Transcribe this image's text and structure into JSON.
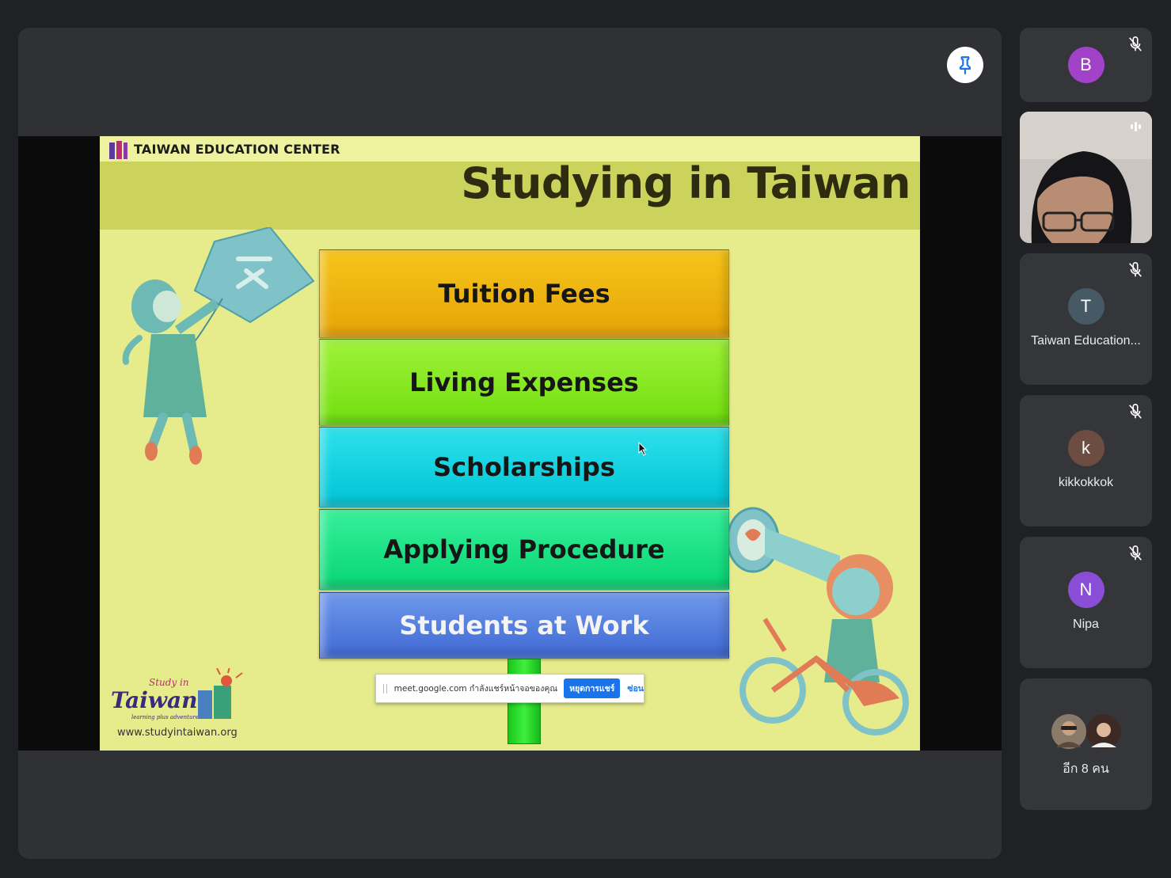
{
  "presentation": {
    "org_label": "TAIWAN EDUCATION CENTER",
    "slide_title": "Studying in Taiwan",
    "blocks": [
      "Tuition Fees",
      "Living Expenses",
      "Scholarships",
      "Applying Procedure",
      "Students at Work"
    ],
    "logo_url_text": "www.studyintaiwan.org",
    "logo_wordmark": "Taiwan",
    "logo_tagline": "Study in",
    "logo_subtagline": "learning plus adventure"
  },
  "share_bar": {
    "message": "meet.google.com กำลังแชร์หน้าจอของคุณ",
    "stop_label": "หยุดการแชร์",
    "hide_label": "ซ่อน"
  },
  "participants": [
    {
      "initial": "B",
      "name": "",
      "color": "#a142c8",
      "muted": true
    },
    {
      "initial": "",
      "name": "",
      "video": true,
      "speaking": true
    },
    {
      "initial": "T",
      "name": "Taiwan Education...",
      "color": "#455a64",
      "muted": true
    },
    {
      "initial": "k",
      "name": "kikkokkok",
      "color": "#6d4c41",
      "muted": true
    },
    {
      "initial": "N",
      "name": "Nipa",
      "color": "#8a4dd6",
      "muted": true
    }
  ],
  "more": {
    "label": "อีก 8 คน"
  },
  "colors": {
    "background": "#202124",
    "tile": "#35363a",
    "accent_blue": "#1a73e8"
  },
  "icons": [
    "pin-icon",
    "mic-off-icon",
    "speaking-icon",
    "cursor-icon"
  ]
}
